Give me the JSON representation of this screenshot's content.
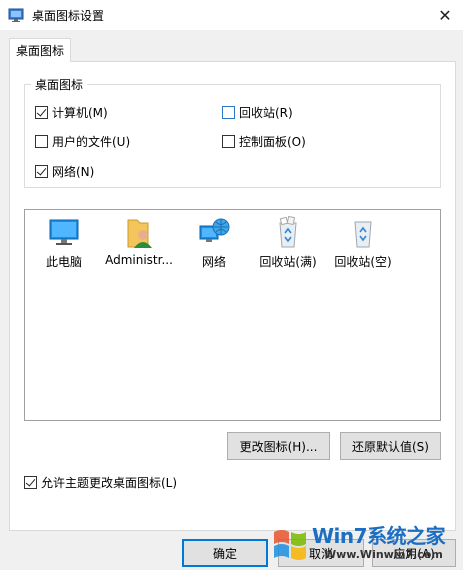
{
  "window": {
    "title": "桌面图标设置"
  },
  "tab": {
    "label": "桌面图标"
  },
  "group": {
    "legend": "桌面图标",
    "checkboxes": [
      {
        "label": "计算机(M)",
        "checked": true
      },
      {
        "label": "回收站(R)",
        "checked": false
      },
      {
        "label": "用户的文件(U)",
        "checked": false
      },
      {
        "label": "控制面板(O)",
        "checked": false
      },
      {
        "label": "网络(N)",
        "checked": true
      }
    ]
  },
  "icons": [
    {
      "label": "此电脑",
      "icon": "this-pc-icon"
    },
    {
      "label": "Administr...",
      "icon": "user-folder-icon"
    },
    {
      "label": "网络",
      "icon": "network-icon"
    },
    {
      "label": "回收站(满)",
      "icon": "recycle-bin-full-icon"
    },
    {
      "label": "回收站(空)",
      "icon": "recycle-bin-empty-icon"
    }
  ],
  "buttons": {
    "change_icon": "更改图标(H)...",
    "restore_default": "还原默认值(S)",
    "ok": "确定",
    "cancel": "取消",
    "apply": "应用(A)"
  },
  "allow_themes": {
    "label": "允许主题更改桌面图标(L)",
    "checked": true
  },
  "watermark": {
    "brand": "Win7系统之家",
    "url": "Www.Winwin7.com"
  },
  "colors": {
    "accent": "#0078d7",
    "checkbox_focus": "#2b78c6"
  }
}
